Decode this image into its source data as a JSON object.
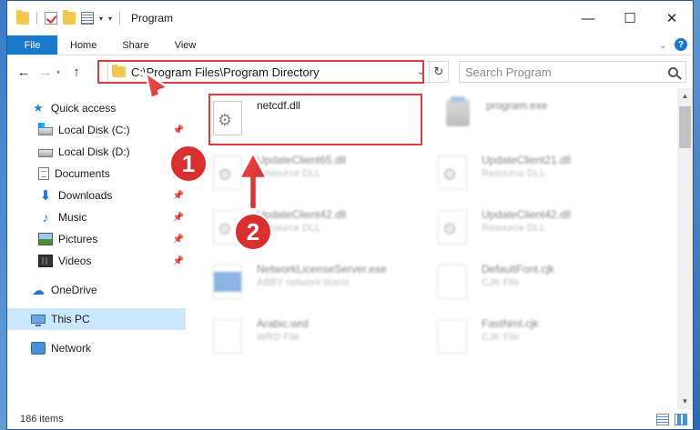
{
  "window": {
    "title": "Program",
    "controls": {
      "minimize": "—",
      "maximize": "☐",
      "close": "✕"
    }
  },
  "ribbon": {
    "tabs": [
      {
        "label": "File"
      },
      {
        "label": "Home"
      },
      {
        "label": "Share"
      },
      {
        "label": "View"
      }
    ]
  },
  "address": {
    "path": "C:\\Program Files\\Program Directory",
    "search_placeholder": "Search Program"
  },
  "sidebar": {
    "items": [
      {
        "label": "Quick access",
        "icon": "star-icon"
      },
      {
        "label": "Local Disk (C:)",
        "icon": "drive-c-icon"
      },
      {
        "label": "Local Disk (D:)",
        "icon": "drive-d-icon"
      },
      {
        "label": "Documents",
        "icon": "documents-icon"
      },
      {
        "label": "Downloads",
        "icon": "downloads-icon"
      },
      {
        "label": "Music",
        "icon": "music-icon"
      },
      {
        "label": "Pictures",
        "icon": "pictures-icon"
      },
      {
        "label": "Videos",
        "icon": "videos-icon"
      },
      {
        "label": "OneDrive",
        "icon": "onedrive-icon"
      },
      {
        "label": "This PC",
        "icon": "this-pc-icon"
      },
      {
        "label": "Network",
        "icon": "network-icon"
      }
    ]
  },
  "files": [
    {
      "name": "netcdf.dll",
      "type": ""
    },
    {
      "name": "program.exe",
      "type": ""
    },
    {
      "name": "UpdateClient65.dll",
      "type": "Resource DLL"
    },
    {
      "name": "UpdateClient21.dll",
      "type": "Resource DLL"
    },
    {
      "name": "UpdateClient42.dll",
      "type": "Resource DLL"
    },
    {
      "name": "UpdateClient42.dll",
      "type": "Resource DLL"
    },
    {
      "name": "NetworkLicenseServer.exe",
      "type": "ABBY network licens"
    },
    {
      "name": "DefaultFont.cjk",
      "type": "CJK File"
    },
    {
      "name": "Arabic.wrd",
      "type": "WRD File"
    },
    {
      "name": "FastNml.cjk",
      "type": "CJK File"
    }
  ],
  "status": {
    "item_count": "186 items"
  },
  "annotations": {
    "step1": "1",
    "step2": "2"
  },
  "colors": {
    "accent": "#1979ca",
    "highlight": "#e03a3e"
  }
}
